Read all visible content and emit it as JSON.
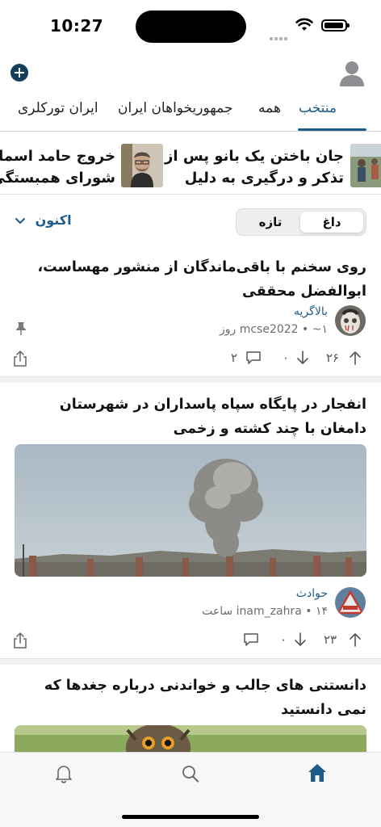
{
  "status_bar": {
    "time": "10:27"
  },
  "tabs": [
    {
      "label": "منتخب",
      "active": true
    },
    {
      "label": "همه",
      "active": false
    },
    {
      "label": "جمهوریخواهان ایران",
      "active": false
    },
    {
      "label": "ایران تورکلری",
      "active": false
    }
  ],
  "trending": [
    {
      "line1": "جان باختن یک بانو پس از",
      "line2": "تذکر و درگیری به دلیل"
    },
    {
      "line1": "خروج حامد اسماعی",
      "line2": "شورای همبستگی"
    }
  ],
  "sort": {
    "options": [
      "داغ",
      "تازه"
    ],
    "selected": "داغ",
    "time_filter": "اکنون"
  },
  "posts": [
    {
      "title": "روی سخنم با باقی‌ماندگان از منشور مهساست، ابوالفضل محققی",
      "community": "بالاگریه",
      "user": "mcse2022",
      "age": "~۱ روز",
      "upvotes": "۲۶",
      "downvotes": "۰",
      "comments": "۲",
      "pinned": true
    },
    {
      "title": "انفجار در پایگاه سپاه پاسداران در شهرستان دامغان با چند کشته و زخمی",
      "community": "حوادث",
      "user": "inam_zahra",
      "age": "۱۴ ساعت",
      "upvotes": "۲۳",
      "downvotes": "۰",
      "comments": ""
    },
    {
      "title": "دانستنی های جالب و خواندنی درباره جغدها که نمی دانستید"
    }
  ],
  "colors": {
    "accent": "#1d5c8a",
    "add_button": "#133f5c"
  }
}
